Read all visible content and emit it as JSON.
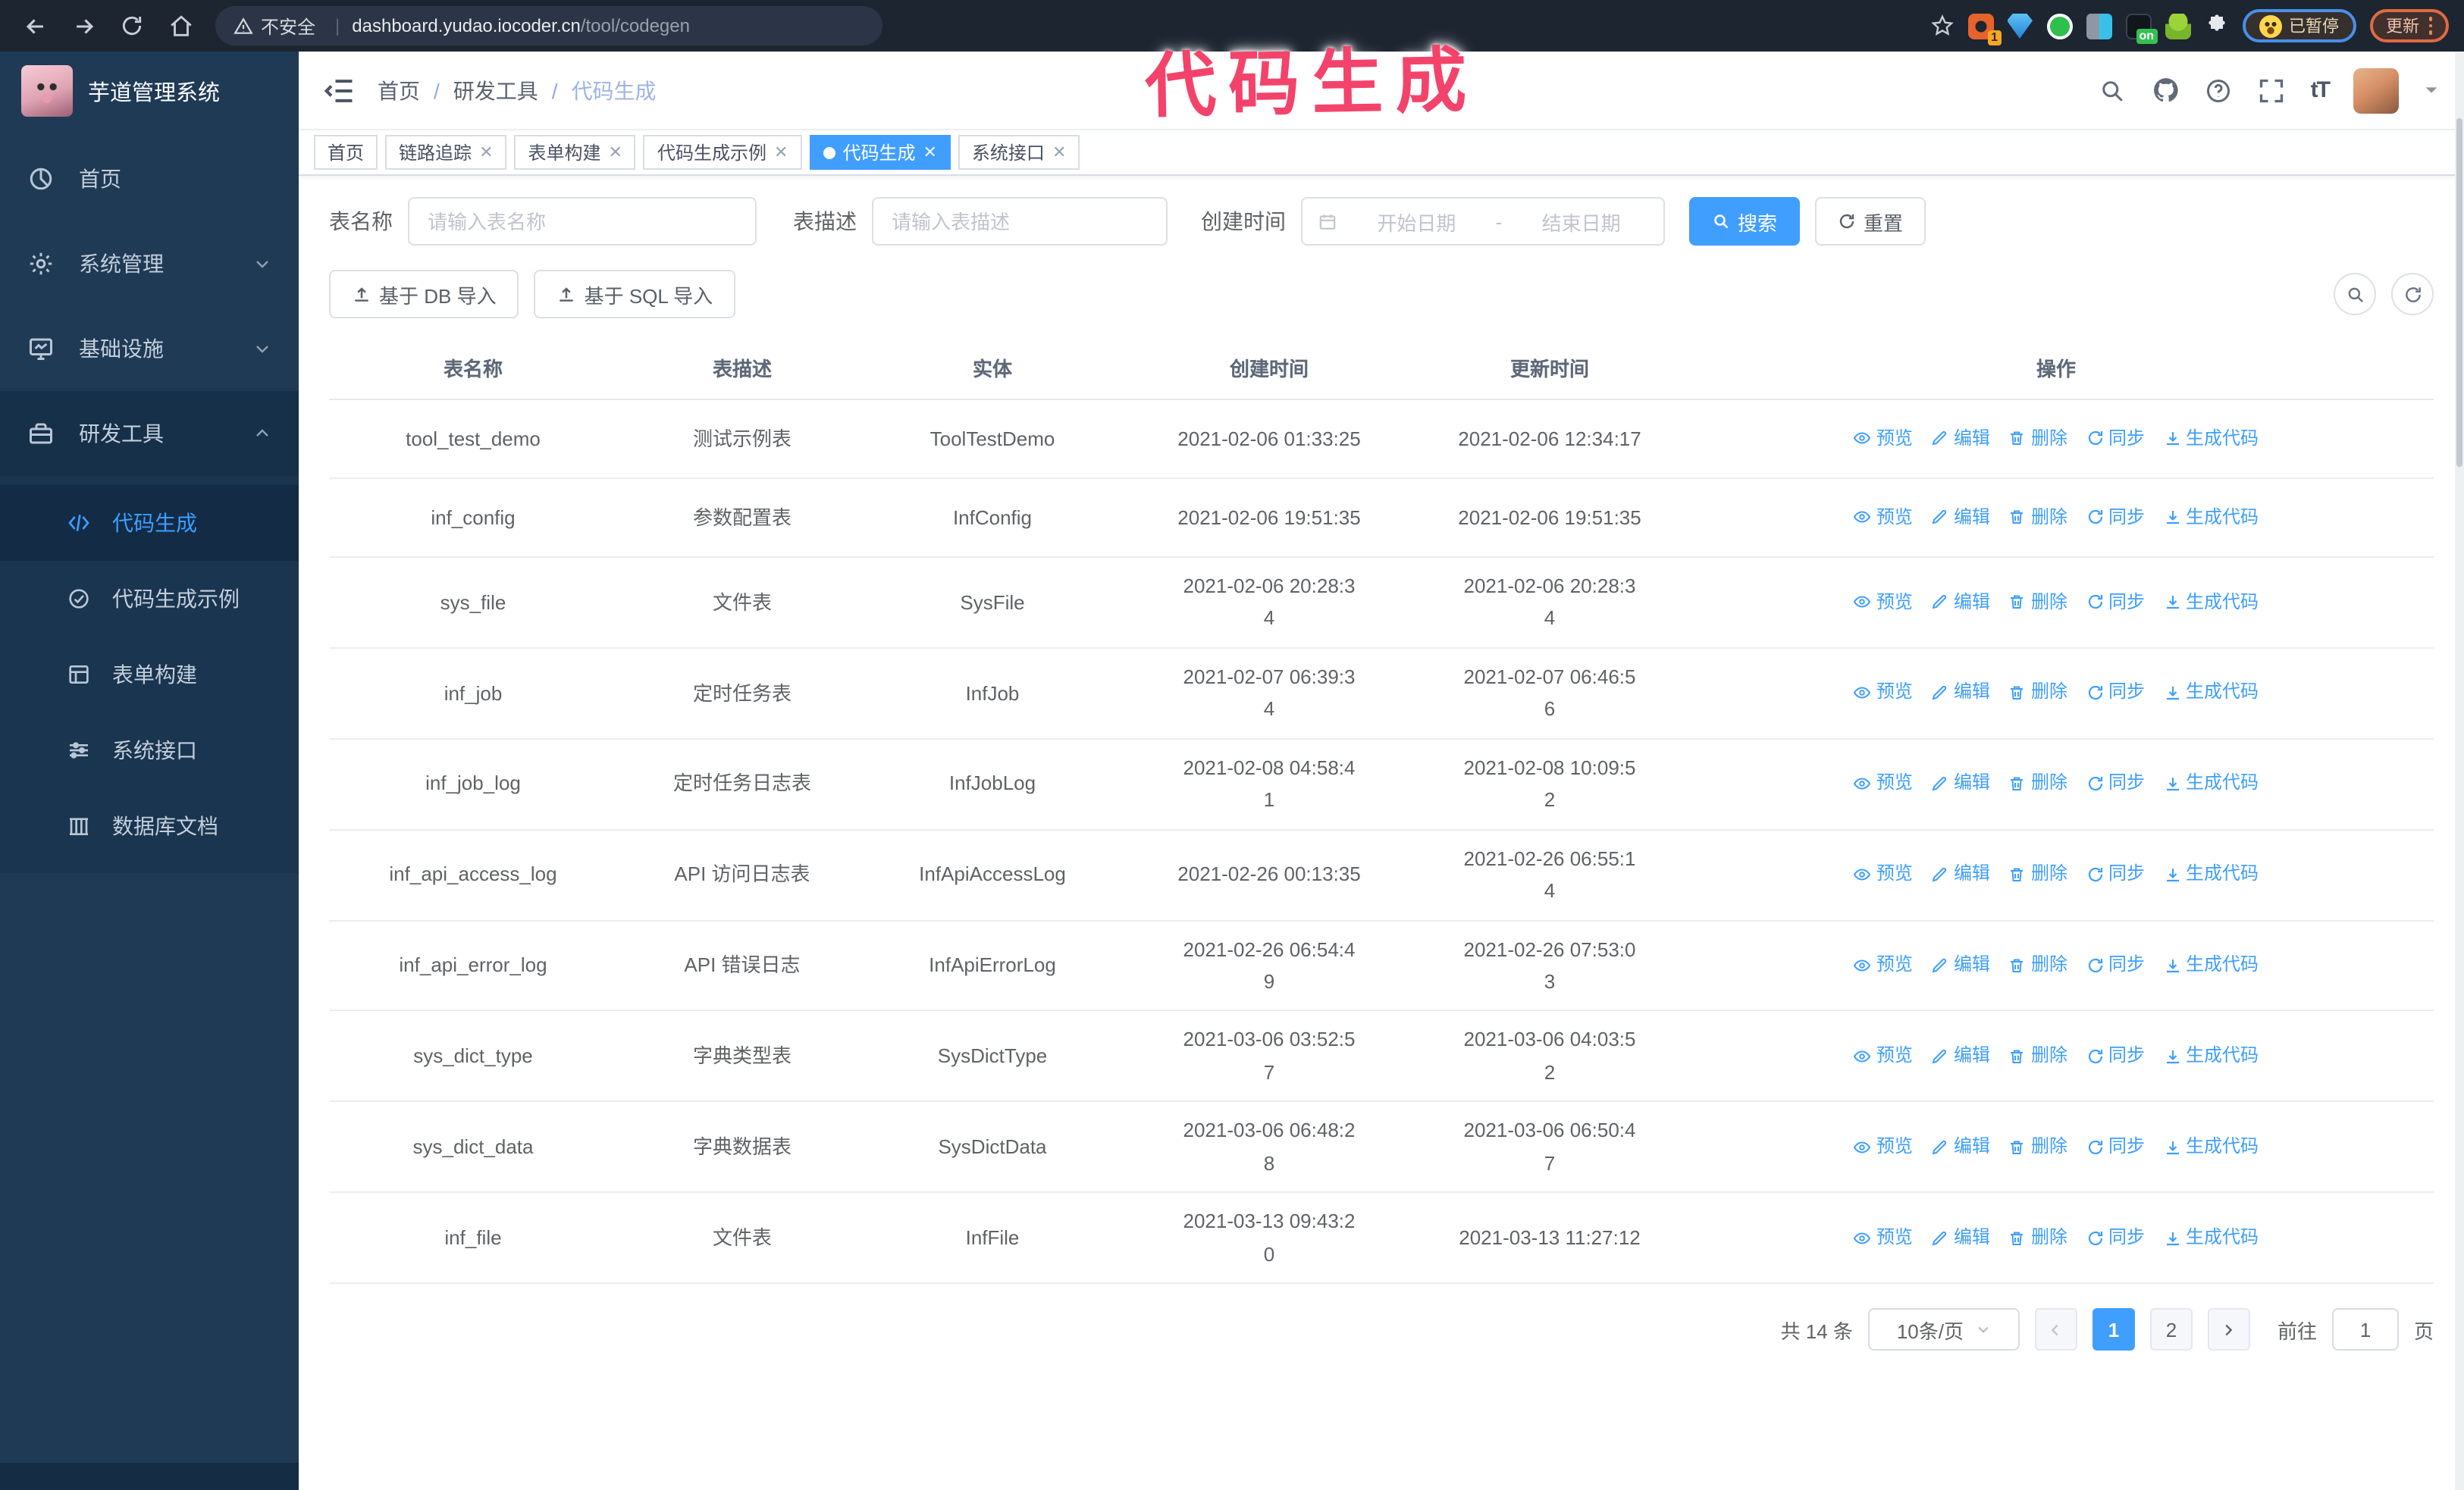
{
  "browser": {
    "security_label": "不安全",
    "url_domain": "dashboard.yudao.iocoder.cn",
    "url_path": "/tool/codegen",
    "ext_badge_count": "1",
    "ext_badge_on": "on",
    "paused_badge": "已暂停",
    "update_button": "更新"
  },
  "annotation": {
    "text": "代码生成",
    "color": "#f4436b"
  },
  "sidebar": {
    "logo_title": "芋道管理系统",
    "items": [
      {
        "label": "首页"
      },
      {
        "label": "系统管理"
      },
      {
        "label": "基础设施"
      },
      {
        "label": "研发工具"
      }
    ],
    "submenu": [
      {
        "label": "代码生成"
      },
      {
        "label": "代码生成示例"
      },
      {
        "label": "表单构建"
      },
      {
        "label": "系统接口"
      },
      {
        "label": "数据库文档"
      }
    ]
  },
  "navbar": {
    "breadcrumb": {
      "home": "首页",
      "parent": "研发工具",
      "current": "代码生成"
    }
  },
  "tabs": [
    {
      "label": "首页"
    },
    {
      "label": "链路追踪"
    },
    {
      "label": "表单构建"
    },
    {
      "label": "代码生成示例"
    },
    {
      "label": "代码生成"
    },
    {
      "label": "系统接口"
    }
  ],
  "search": {
    "name_label": "表名称",
    "name_placeholder": "请输入表名称",
    "desc_label": "表描述",
    "desc_placeholder": "请输入表描述",
    "time_label": "创建时间",
    "start_placeholder": "开始日期",
    "range_separator": "-",
    "end_placeholder": "结束日期",
    "search_button": "搜索",
    "reset_button": "重置"
  },
  "toolbar": {
    "import_db": "基于 DB 导入",
    "import_sql": "基于 SQL 导入"
  },
  "table": {
    "columns": [
      "表名称",
      "表描述",
      "实体",
      "创建时间",
      "更新时间",
      "操作"
    ],
    "actions": [
      "预览",
      "编辑",
      "删除",
      "同步",
      "生成代码"
    ],
    "rows": [
      {
        "name": "tool_test_demo",
        "desc": "测试示例表",
        "entity": "ToolTestDemo",
        "created": "2021-02-06 01:33:25",
        "updated": "2021-02-06 12:34:17"
      },
      {
        "name": "inf_config",
        "desc": "参数配置表",
        "entity": "InfConfig",
        "created": "2021-02-06 19:51:35",
        "updated": "2021-02-06 19:51:35"
      },
      {
        "name": "sys_file",
        "desc": "文件表",
        "entity": "SysFile",
        "created": "2021-02-06 20:28:3\n4",
        "updated": "2021-02-06 20:28:3\n4"
      },
      {
        "name": "inf_job",
        "desc": "定时任务表",
        "entity": "InfJob",
        "created": "2021-02-07 06:39:3\n4",
        "updated": "2021-02-07 06:46:5\n6"
      },
      {
        "name": "inf_job_log",
        "desc": "定时任务日志表",
        "entity": "InfJobLog",
        "created": "2021-02-08 04:58:4\n1",
        "updated": "2021-02-08 10:09:5\n2"
      },
      {
        "name": "inf_api_access_log",
        "desc": "API 访问日志表",
        "entity": "InfApiAccessLog",
        "created": "2021-02-26 00:13:35",
        "updated": "2021-02-26 06:55:1\n4"
      },
      {
        "name": "inf_api_error_log",
        "desc": "API 错误日志",
        "entity": "InfApiErrorLog",
        "created": "2021-02-26 06:54:4\n9",
        "updated": "2021-02-26 07:53:0\n3"
      },
      {
        "name": "sys_dict_type",
        "desc": "字典类型表",
        "entity": "SysDictType",
        "created": "2021-03-06 03:52:5\n7",
        "updated": "2021-03-06 04:03:5\n2"
      },
      {
        "name": "sys_dict_data",
        "desc": "字典数据表",
        "entity": "SysDictData",
        "created": "2021-03-06 06:48:2\n8",
        "updated": "2021-03-06 06:50:4\n7"
      },
      {
        "name": "inf_file",
        "desc": "文件表",
        "entity": "InfFile",
        "created": "2021-03-13 09:43:2\n0",
        "updated": "2021-03-13 11:27:12"
      }
    ]
  },
  "pagination": {
    "total": "共 14 条",
    "page_size": "10条/页",
    "page_1": "1",
    "page_2": "2",
    "goto_label": "前往",
    "goto_value": "1",
    "page_suffix": "页"
  }
}
